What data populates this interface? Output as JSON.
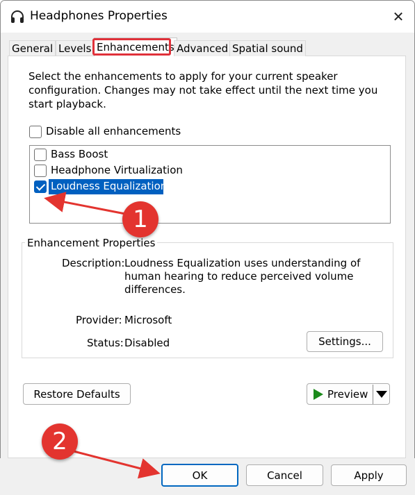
{
  "window": {
    "title": "Headphones Properties",
    "close_glyph": "✕"
  },
  "tabs": [
    {
      "label": "General"
    },
    {
      "label": "Levels"
    },
    {
      "label": "Enhancements",
      "active": true
    },
    {
      "label": "Advanced"
    },
    {
      "label": "Spatial sound"
    }
  ],
  "intro_text": "Select the enhancements to apply for your current speaker configuration. Changes may not take effect until the next time you start playback.",
  "disable_all": {
    "label": "Disable all enhancements",
    "checked": false
  },
  "enhancements": [
    {
      "label": "Bass Boost",
      "checked": false
    },
    {
      "label": "Headphone Virtualization",
      "checked": false
    },
    {
      "label": "Loudness Equalization",
      "checked": true,
      "selected": true
    }
  ],
  "properties": {
    "group_title": "Enhancement Properties",
    "description_label": "Description:",
    "description_value": "Loudness Equalization uses understanding of human hearing to reduce perceived volume differences.",
    "provider_label": "Provider:",
    "provider_value": "Microsoft",
    "status_label": "Status:",
    "status_value": "Disabled",
    "settings_button": "Settings..."
  },
  "restore_defaults_button": "Restore Defaults",
  "preview_button": "Preview",
  "footer": {
    "ok": "OK",
    "cancel": "Cancel",
    "apply": "Apply"
  },
  "annotations": [
    {
      "number": "1"
    },
    {
      "number": "2"
    }
  ],
  "colors": {
    "accent": "#0060c0",
    "annotation": "#e3342f",
    "play": "#1a8a1a"
  },
  "icons": {
    "app": "headphones-icon",
    "close": "close-icon",
    "play": "play-icon",
    "dropdown": "chevron-down-icon"
  }
}
